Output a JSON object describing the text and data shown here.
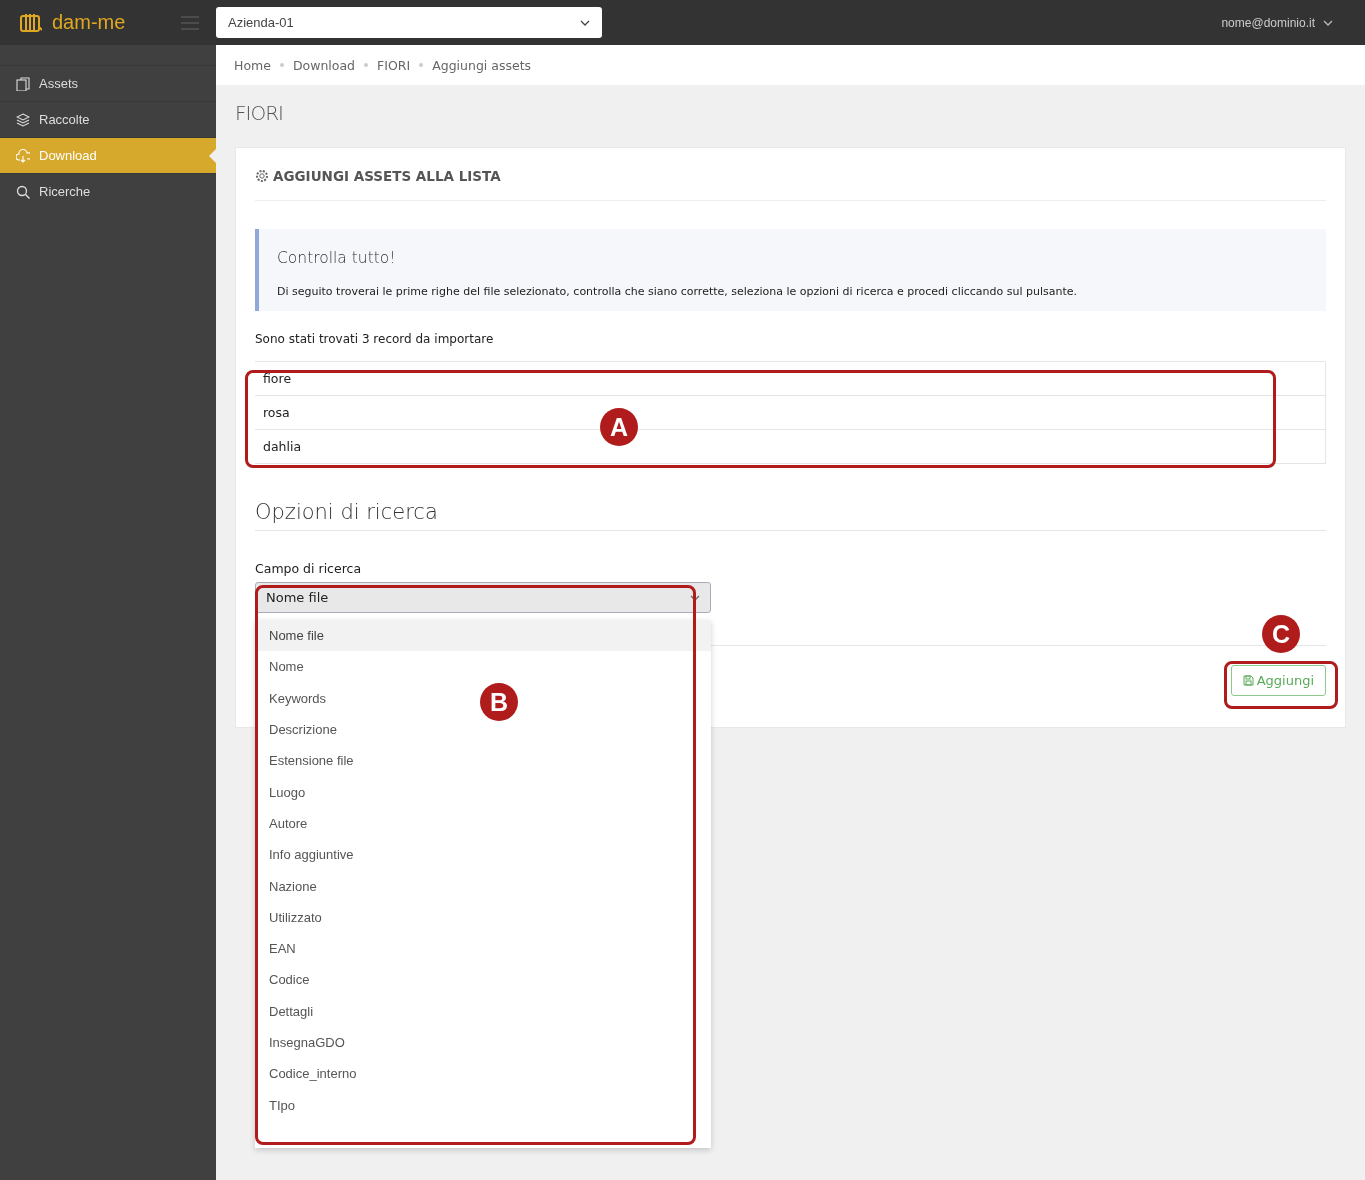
{
  "topbar": {
    "logo": "dam-me",
    "company_select": {
      "value": "Azienda-01"
    },
    "user_menu": "nome@dominio.it"
  },
  "sidebar": {
    "items": [
      {
        "label": "Assets",
        "kind": "files",
        "selected": false
      },
      {
        "label": "Raccolte",
        "kind": "layers",
        "selected": false
      },
      {
        "label": "Download",
        "kind": "cloud",
        "selected": true
      },
      {
        "label": "Ricerche",
        "kind": "search",
        "selected": false
      }
    ]
  },
  "breadcrumb": [
    "Home",
    "Download",
    "FIORI",
    "Aggiungi assets"
  ],
  "page_title": "FIORI",
  "card": {
    "title": "AGGIUNGI ASSETS ALLA LISTA",
    "alert": {
      "heading": "Controlla tutto!",
      "text": "Di seguito troverai le prime righe del file selezionato, controlla che siano corrette, seleziona le opzioni di ricerca e procedi cliccando sul pulsante."
    },
    "records_note": "Sono stati trovati 3 record da importare",
    "records": [
      "fiore",
      "rosa",
      "dahlia"
    ],
    "options_heading": "Opzioni di ricerca",
    "search_field": {
      "label": "Campo di ricerca",
      "value": "Nome file",
      "expanded": true,
      "options": [
        {
          "label": "Nome file",
          "selected": true
        },
        {
          "label": "Nome",
          "selected": false
        },
        {
          "label": "Keywords",
          "selected": false
        },
        {
          "label": "Descrizione",
          "selected": false
        },
        {
          "label": "Estensione file",
          "selected": false
        },
        {
          "label": "Luogo",
          "selected": false
        },
        {
          "label": "Autore",
          "selected": false
        },
        {
          "label": "Info aggiuntive",
          "selected": false
        },
        {
          "label": "Nazione",
          "selected": false
        },
        {
          "label": "Utilizzato",
          "selected": false
        },
        {
          "label": "EAN",
          "selected": false
        },
        {
          "label": "Codice",
          "selected": false
        },
        {
          "label": "Dettagli",
          "selected": false
        },
        {
          "label": "InsegnaGDO",
          "selected": false
        },
        {
          "label": "Codice_interno",
          "selected": false
        },
        {
          "label": "TIpo",
          "selected": false
        }
      ]
    },
    "add_button": "Aggiungi"
  },
  "annotations": [
    {
      "label": "A"
    },
    {
      "label": "B"
    },
    {
      "label": "C"
    }
  ]
}
